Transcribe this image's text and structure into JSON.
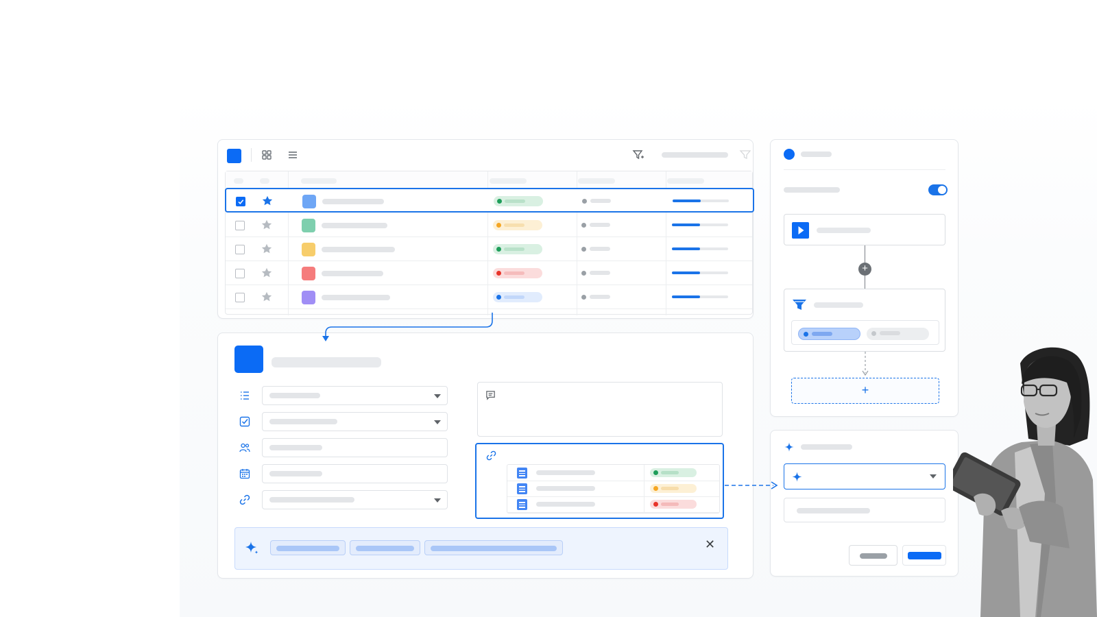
{
  "colors": {
    "brand": "#0b6bf5",
    "accent": "#1a73e8",
    "success": "#1e9e5a",
    "warning": "#f5a623",
    "danger": "#e8342a",
    "info": "#1a73e8"
  },
  "toolbar": {
    "icons": [
      "grid-view-icon",
      "list-view-icon",
      "filter-add-icon",
      "filter-icon"
    ]
  },
  "table": {
    "rows": [
      {
        "checked": true,
        "starred": true,
        "color": "#6ea6f5",
        "status": "success",
        "progress": 0.5
      },
      {
        "checked": false,
        "starred": false,
        "color": "#7ecfae",
        "status": "warning",
        "progress": 0.5
      },
      {
        "checked": false,
        "starred": false,
        "color": "#f7cd6b",
        "status": "success",
        "progress": 0.5
      },
      {
        "checked": false,
        "starred": false,
        "color": "#f57c7c",
        "status": "danger",
        "progress": 0.5
      },
      {
        "checked": false,
        "starred": false,
        "color": "#a08ef5",
        "status": "info",
        "progress": 0.5
      }
    ]
  },
  "form": {
    "field_icons": [
      "list-icon",
      "checkbox-icon",
      "people-icon",
      "calendar-icon",
      "link-icon"
    ],
    "fields_with_dropdown": [
      true,
      true,
      false,
      false,
      true
    ],
    "linked_docs": [
      {
        "status": "success"
      },
      {
        "status": "warning"
      },
      {
        "status": "danger"
      }
    ]
  },
  "workflow": {
    "toggle_on": true,
    "add_step_symbol": "+",
    "plus_symbol": "+"
  },
  "ai_panel": {
    "close_symbol": "✕"
  }
}
